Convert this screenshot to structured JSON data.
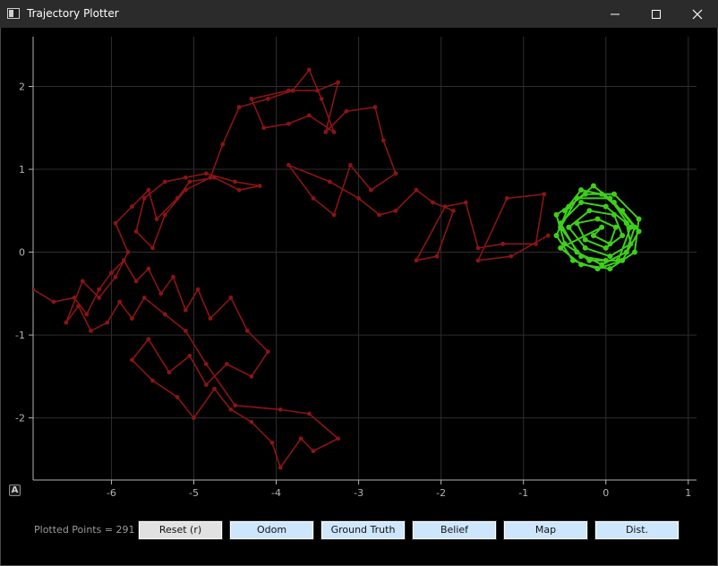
{
  "window": {
    "title": "Trajectory Plotter",
    "controls": [
      "minimize",
      "maximize",
      "close"
    ]
  },
  "plot": {
    "auto_range_label": "A",
    "background": "#000000",
    "grid_color": "#2e2e2e",
    "axis_color": "#b4b4b4"
  },
  "status": {
    "plotted_points": "Plotted Points = 291"
  },
  "buttons": {
    "reset": "Reset (r)",
    "odom": "Odom",
    "ground_truth": "Ground Truth",
    "belief": "Belief",
    "map": "Map",
    "dist": "Dist."
  },
  "chart_data": {
    "type": "line",
    "xlim": [
      -6.95,
      1.1
    ],
    "ylim": [
      -2.75,
      2.6
    ],
    "x_ticks": [
      -6,
      -5,
      -4,
      -3,
      -2,
      -1,
      0,
      1
    ],
    "y_ticks": [
      -2,
      -1,
      0,
      1,
      2
    ],
    "x_tick_labels": [
      "-6",
      "-5",
      "-4",
      "-3",
      "-2",
      "-1",
      "0",
      "1"
    ],
    "y_tick_labels": [
      "-2",
      "-1",
      "0",
      "1",
      "2"
    ],
    "grid": true,
    "series": [
      {
        "color": "#8b1414",
        "points": [
          [
            -6.95,
            -0.45
          ],
          [
            -6.7,
            -0.6
          ],
          [
            -6.45,
            -0.55
          ],
          [
            -6.3,
            -0.75
          ],
          [
            -6.15,
            -0.45
          ],
          [
            -6.0,
            -0.25
          ],
          [
            -5.85,
            -0.1
          ],
          [
            -5.7,
            -0.35
          ],
          [
            -5.55,
            -0.2
          ],
          [
            -5.4,
            -0.5
          ],
          [
            -5.25,
            -0.3
          ],
          [
            -5.1,
            -0.7
          ],
          [
            -4.95,
            -0.45
          ],
          [
            -4.8,
            -0.8
          ],
          [
            -4.55,
            -0.55
          ],
          [
            -4.35,
            -0.95
          ],
          [
            -4.1,
            -1.2
          ],
          [
            -4.3,
            -1.5
          ],
          [
            -4.6,
            -1.35
          ],
          [
            -4.85,
            -1.6
          ],
          [
            -5.05,
            -1.25
          ],
          [
            -5.3,
            -1.45
          ],
          [
            -5.55,
            -1.05
          ],
          [
            -5.75,
            -1.3
          ],
          [
            -5.5,
            -1.55
          ],
          [
            -5.2,
            -1.75
          ],
          [
            -5.0,
            -2.0
          ],
          [
            -4.75,
            -1.65
          ],
          [
            -4.55,
            -1.9
          ],
          [
            -4.3,
            -2.05
          ],
          [
            -4.05,
            -2.3
          ],
          [
            -3.95,
            -2.6
          ],
          [
            -3.7,
            -2.25
          ],
          [
            -3.55,
            -2.4
          ],
          [
            -3.25,
            -2.25
          ],
          [
            -3.6,
            -1.95
          ],
          [
            -3.95,
            -1.9
          ],
          [
            -4.5,
            -1.85
          ],
          [
            -4.85,
            -1.35
          ],
          [
            -5.1,
            -0.95
          ],
          [
            -5.35,
            -0.75
          ],
          [
            -5.6,
            -0.55
          ],
          [
            -5.75,
            -0.8
          ],
          [
            -5.9,
            -0.6
          ],
          [
            -6.05,
            -0.85
          ],
          [
            -6.25,
            -0.95
          ],
          [
            -6.4,
            -0.65
          ],
          [
            -6.55,
            -0.85
          ],
          [
            -6.35,
            -0.35
          ],
          [
            -6.15,
            -0.55
          ],
          [
            -5.95,
            -0.3
          ],
          [
            -5.8,
            0.0
          ],
          [
            -5.95,
            0.35
          ],
          [
            -5.75,
            0.55
          ],
          [
            -5.55,
            0.75
          ],
          [
            -5.45,
            0.4
          ],
          [
            -5.2,
            0.65
          ],
          [
            -5.05,
            0.85
          ],
          [
            -4.75,
            0.9
          ],
          [
            -4.45,
            0.75
          ],
          [
            -4.2,
            0.8
          ],
          [
            -4.5,
            0.85
          ],
          [
            -4.85,
            0.95
          ],
          [
            -5.1,
            0.9
          ],
          [
            -5.35,
            0.85
          ],
          [
            -5.6,
            0.65
          ],
          [
            -5.7,
            0.25
          ],
          [
            -5.5,
            0.05
          ],
          [
            -5.35,
            0.45
          ],
          [
            -5.1,
            0.75
          ],
          [
            -4.8,
            0.9
          ],
          [
            -4.65,
            1.3
          ],
          [
            -4.45,
            1.75
          ],
          [
            -4.1,
            1.85
          ],
          [
            -3.8,
            1.95
          ],
          [
            -3.6,
            2.2
          ],
          [
            -3.45,
            1.85
          ],
          [
            -3.3,
            1.45
          ],
          [
            -3.6,
            1.65
          ],
          [
            -3.85,
            1.55
          ],
          [
            -4.15,
            1.5
          ],
          [
            -4.3,
            1.85
          ],
          [
            -3.85,
            1.95
          ],
          [
            -3.5,
            1.95
          ],
          [
            -3.25,
            2.05
          ],
          [
            -3.4,
            1.45
          ],
          [
            -3.15,
            1.7
          ],
          [
            -2.8,
            1.75
          ],
          [
            -2.7,
            1.35
          ],
          [
            -2.55,
            0.95
          ],
          [
            -2.85,
            0.75
          ],
          [
            -3.1,
            1.05
          ],
          [
            -3.3,
            0.45
          ],
          [
            -3.55,
            0.65
          ],
          [
            -3.85,
            1.05
          ],
          [
            -3.35,
            0.85
          ],
          [
            -3.0,
            0.65
          ],
          [
            -2.75,
            0.45
          ],
          [
            -2.55,
            0.5
          ],
          [
            -2.3,
            0.75
          ],
          [
            -2.1,
            0.6
          ],
          [
            -1.85,
            0.5
          ],
          [
            -2.05,
            -0.05
          ],
          [
            -2.3,
            -0.1
          ],
          [
            -1.95,
            0.55
          ],
          [
            -1.7,
            0.6
          ],
          [
            -1.55,
            0.05
          ],
          [
            -1.25,
            0.1
          ],
          [
            -0.85,
            0.1
          ],
          [
            -0.75,
            0.7
          ],
          [
            -1.2,
            0.65
          ],
          [
            -1.55,
            -0.1
          ],
          [
            -1.15,
            -0.05
          ],
          [
            -0.7,
            0.2
          ]
        ]
      },
      {
        "color": "#3ecf1b",
        "points": [
          [
            -0.5,
            0.5
          ],
          [
            -0.3,
            0.75
          ],
          [
            -0.05,
            0.7
          ],
          [
            0.2,
            0.5
          ],
          [
            0.4,
            0.25
          ],
          [
            0.2,
            -0.1
          ],
          [
            -0.1,
            -0.2
          ],
          [
            -0.4,
            -0.1
          ],
          [
            -0.6,
            0.2
          ],
          [
            -0.45,
            0.55
          ],
          [
            -0.15,
            0.8
          ],
          [
            0.1,
            0.6
          ],
          [
            0.35,
            0.3
          ],
          [
            0.25,
            0.0
          ],
          [
            -0.05,
            -0.15
          ],
          [
            -0.35,
            0.0
          ],
          [
            -0.55,
            0.35
          ],
          [
            -0.3,
            0.6
          ],
          [
            0.0,
            0.55
          ],
          [
            0.25,
            0.35
          ],
          [
            0.3,
            0.1
          ],
          [
            0.05,
            -0.05
          ],
          [
            -0.25,
            0.05
          ],
          [
            -0.45,
            0.3
          ],
          [
            -0.2,
            0.5
          ],
          [
            0.1,
            0.45
          ],
          [
            0.2,
            0.2
          ],
          [
            0.0,
            0.05
          ],
          [
            -0.25,
            0.15
          ],
          [
            -0.35,
            0.35
          ],
          [
            -0.1,
            0.4
          ],
          [
            0.12,
            0.3
          ],
          [
            0.05,
            0.1
          ],
          [
            -0.15,
            0.2
          ],
          [
            -0.05,
            0.3
          ],
          [
            -0.55,
            0.05
          ],
          [
            -0.3,
            -0.15
          ],
          [
            0.05,
            -0.2
          ],
          [
            0.35,
            0.0
          ],
          [
            0.4,
            0.4
          ],
          [
            0.1,
            0.7
          ],
          [
            -0.25,
            0.7
          ],
          [
            -0.6,
            0.45
          ],
          [
            -0.5,
            0.1
          ],
          [
            -0.2,
            -0.1
          ],
          [
            0.15,
            -0.1
          ],
          [
            0.3,
            0.3
          ],
          [
            0.05,
            0.65
          ],
          [
            -0.35,
            0.65
          ],
          [
            -0.55,
            0.3
          ],
          [
            -0.3,
            -0.05
          ],
          [
            0.0,
            -0.1
          ]
        ]
      }
    ]
  }
}
